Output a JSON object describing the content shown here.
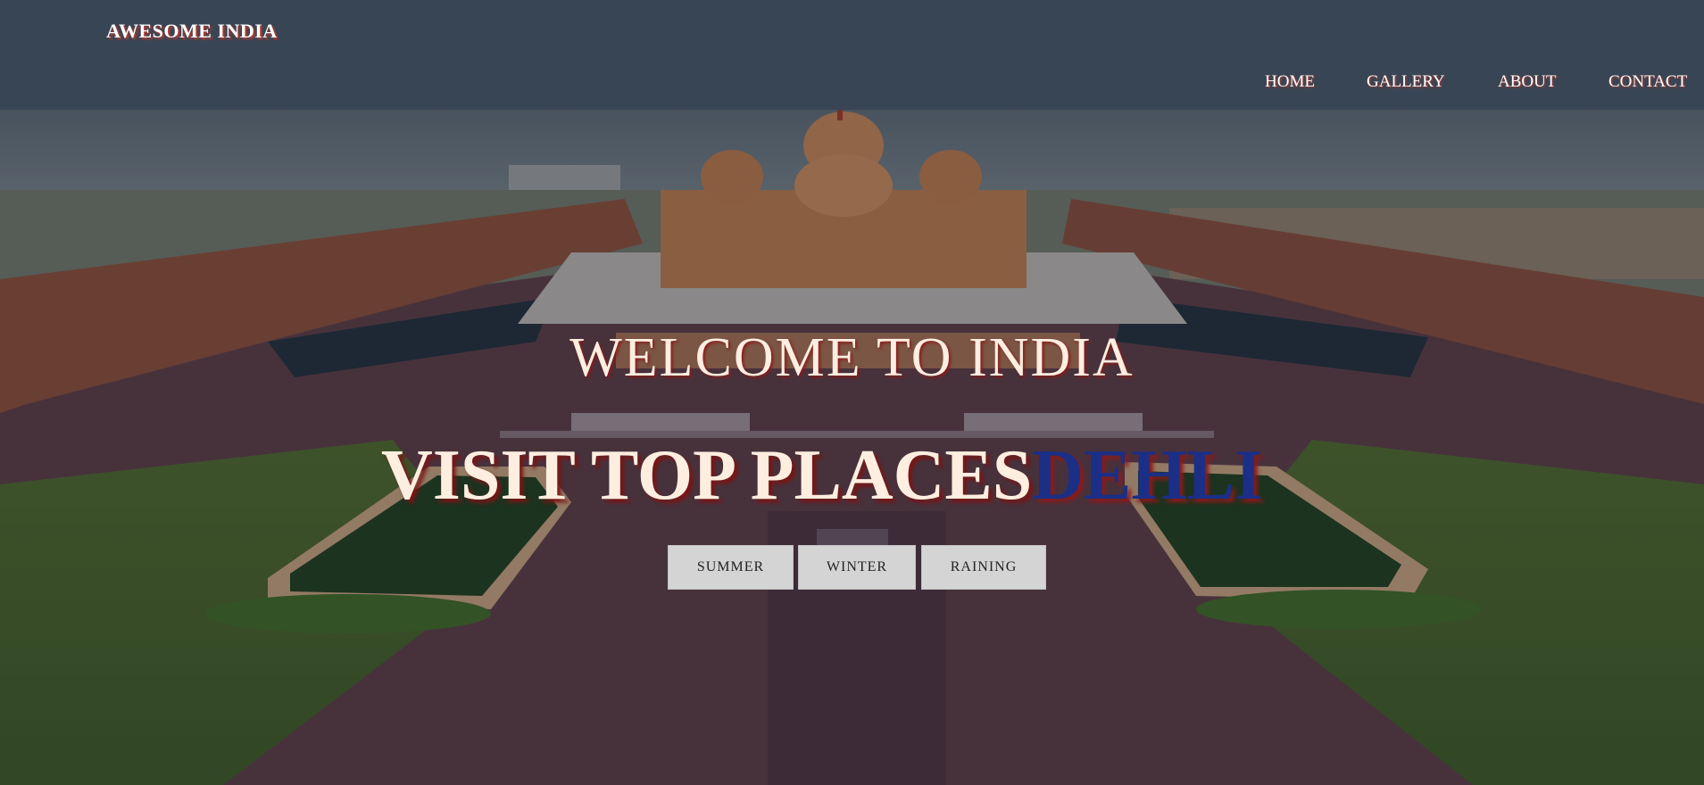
{
  "brand": "AWESOME INDIA",
  "nav": [
    "HOME",
    "GALLERY",
    "ABOUT",
    "CONTACT"
  ],
  "hero": {
    "welcome": "WELCOME TO INDIA",
    "headline": "VISIT TOP PLACES",
    "highlight": "DEHLI",
    "image": "akshardham-temple-aerial-photo"
  },
  "season_buttons": [
    "SUMMER",
    "WINTER",
    "RAINING"
  ],
  "colors": {
    "navbar": "#384554",
    "text_light": "#fdeee0",
    "text_shadow": "#c0392b",
    "highlight": "#1b2f86",
    "button_bg": "#d4d4d4"
  }
}
